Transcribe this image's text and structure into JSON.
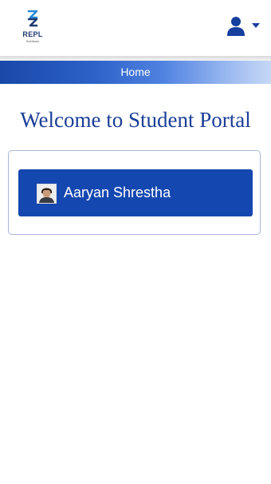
{
  "header": {
    "logo": {
      "text": "REPL",
      "subtext": "Solutions"
    },
    "user_menu": {
      "icon": "user-icon",
      "caret_icon": "caret-down-icon"
    }
  },
  "nav": {
    "home_label": "Home"
  },
  "main": {
    "welcome_text": "Welcome to Student Portal",
    "students": [
      {
        "name": "Aaryan Shrestha",
        "avatar_icon": "student-photo"
      }
    ]
  },
  "colors": {
    "primary": "#1447b0",
    "heading": "#1b3e97",
    "card_border": "#a9b6d6"
  }
}
